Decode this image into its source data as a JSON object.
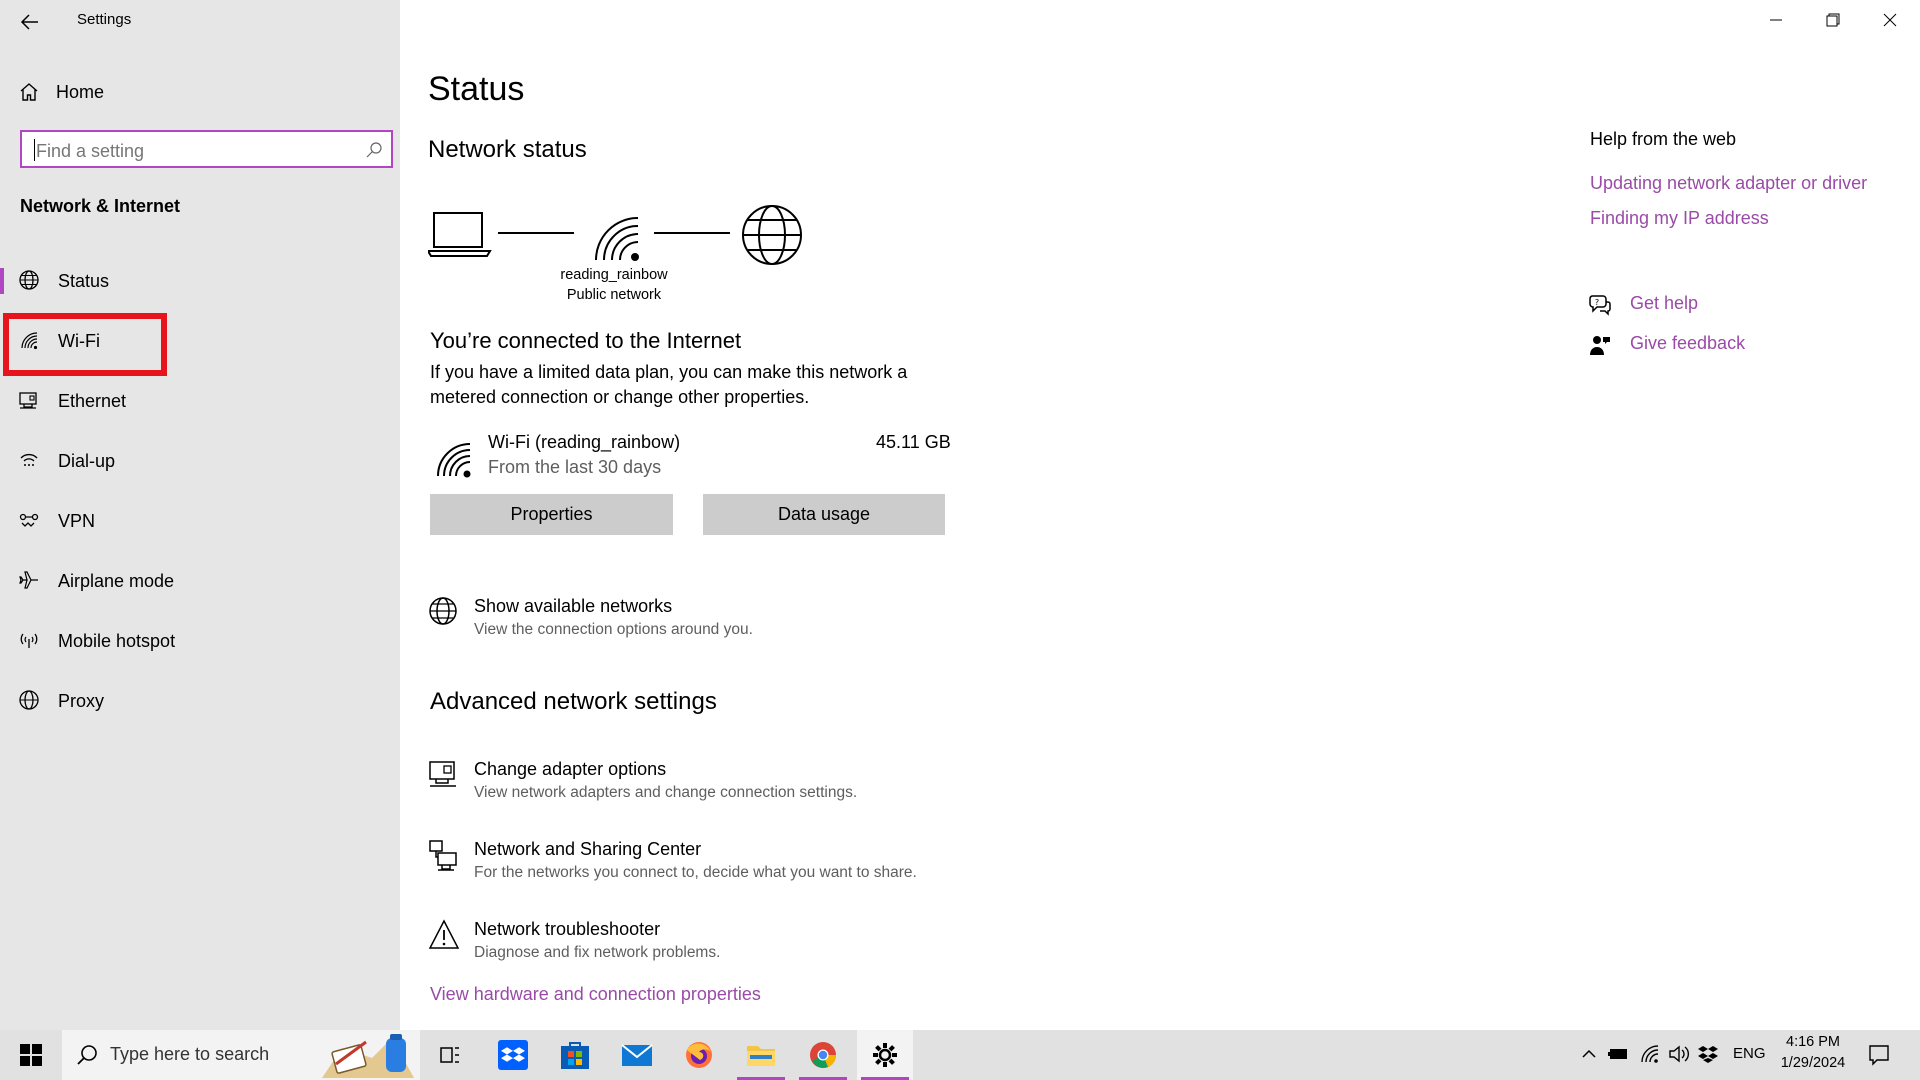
{
  "window": {
    "app_title": "Settings",
    "controls": [
      "minimize",
      "restore",
      "close"
    ]
  },
  "sidebar": {
    "home_label": "Home",
    "search_placeholder": "Find a setting",
    "section_title": "Network & Internet",
    "selected": "Status",
    "highlighted_item": "Wi-Fi",
    "items": [
      {
        "label": "Status",
        "icon": "globe-icon"
      },
      {
        "label": "Wi-Fi",
        "icon": "wifi-icon"
      },
      {
        "label": "Ethernet",
        "icon": "ethernet-icon"
      },
      {
        "label": "Dial-up",
        "icon": "dialup-icon"
      },
      {
        "label": "VPN",
        "icon": "vpn-icon"
      },
      {
        "label": "Airplane mode",
        "icon": "airplane-icon"
      },
      {
        "label": "Mobile hotspot",
        "icon": "hotspot-icon"
      },
      {
        "label": "Proxy",
        "icon": "globe-icon"
      }
    ]
  },
  "main": {
    "page_title": "Status",
    "network_status": {
      "heading": "Network status",
      "network_name": "reading_rainbow",
      "network_type": "Public network",
      "connected_heading": "You’re connected to the Internet",
      "description": "If you have a limited data plan, you can make this network a metered connection or change other properties.",
      "connection_name": "Wi-Fi (reading_rainbow)",
      "connection_period": "From the last 30 days",
      "data_used": "45.11 GB",
      "properties_button": "Properties",
      "data_usage_button": "Data usage"
    },
    "show_networks": {
      "title": "Show available networks",
      "subtitle": "View the connection options around you."
    },
    "advanced": {
      "heading": "Advanced network settings",
      "items": [
        {
          "title": "Change adapter options",
          "subtitle": "View network adapters and change connection settings.",
          "icon": "adapter-icon"
        },
        {
          "title": "Network and Sharing Center",
          "subtitle": "For the networks you connect to, decide what you want to share.",
          "icon": "sharing-center-icon"
        },
        {
          "title": "Network troubleshooter",
          "subtitle": "Diagnose and fix network problems.",
          "icon": "warning-icon"
        }
      ],
      "hardware_link": "View hardware and connection properties"
    }
  },
  "help_panel": {
    "heading": "Help from the web",
    "links": [
      "Updating network adapter or driver",
      "Finding my IP address"
    ],
    "get_help": "Get help",
    "give_feedback": "Give feedback"
  },
  "taskbar": {
    "search_text": "Type here to search",
    "apps": [
      "task-view-icon",
      "dropbox-icon",
      "store-icon",
      "mail-icon",
      "firefox-icon",
      "file-explorer-icon",
      "chrome-icon",
      "settings-icon"
    ],
    "language": "ENG",
    "time": "4:16 PM",
    "date": "1/29/2024"
  },
  "colors": {
    "accent": "#b146c2",
    "link": "#9a4aa7",
    "highlight_box": "#e8141d",
    "sidebar_bg": "#e6e6e6",
    "button_bg": "#cccccc",
    "taskbar_bg": "#e1e1e1"
  }
}
